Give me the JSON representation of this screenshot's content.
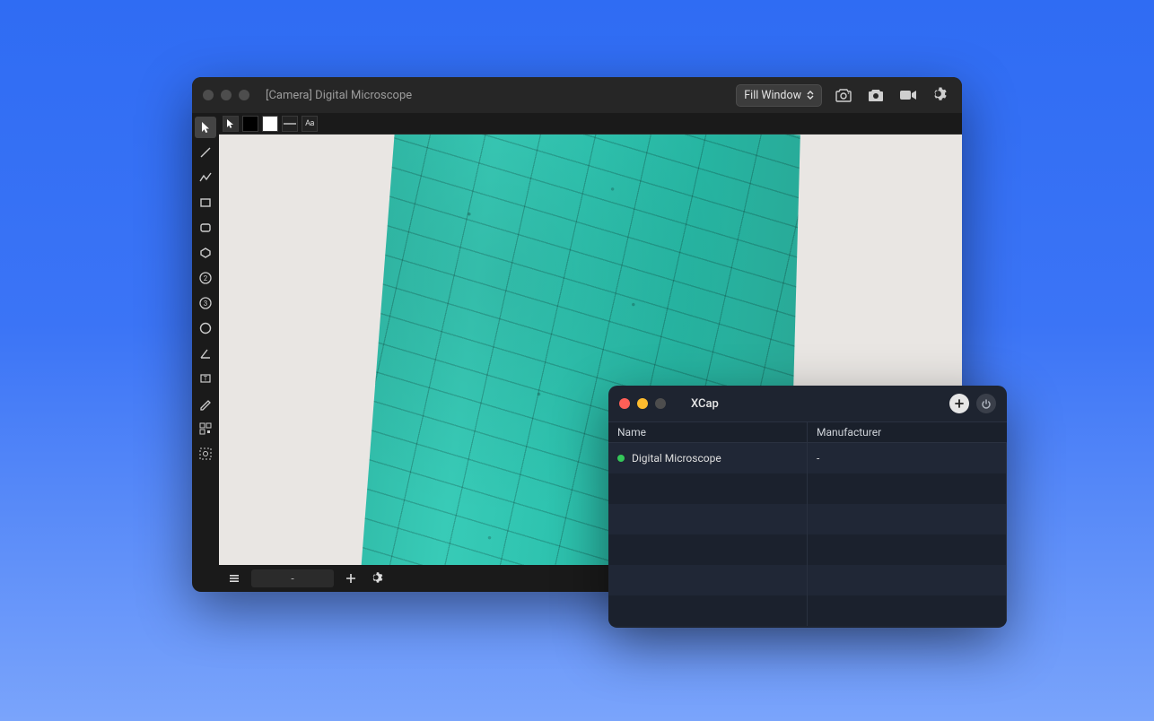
{
  "mainWindow": {
    "title": "[Camera] Digital Microscope",
    "zoomSelect": {
      "value": "Fill Window"
    },
    "optionsBar": {
      "textLabel": "Aa"
    },
    "bottomBar": {
      "fieldValue": "-"
    },
    "tools": [
      "pointer",
      "line",
      "polyline",
      "rectangle",
      "rounded-rectangle",
      "polygon",
      "counter-2",
      "counter-3",
      "circle",
      "angle",
      "text-box",
      "pencil",
      "qr",
      "focus"
    ]
  },
  "xcapWindow": {
    "title": "XCap",
    "columns": {
      "name": "Name",
      "manufacturer": "Manufacturer"
    },
    "rows": [
      {
        "status": "online",
        "name": "Digital Microscope",
        "manufacturer": "-"
      }
    ]
  }
}
